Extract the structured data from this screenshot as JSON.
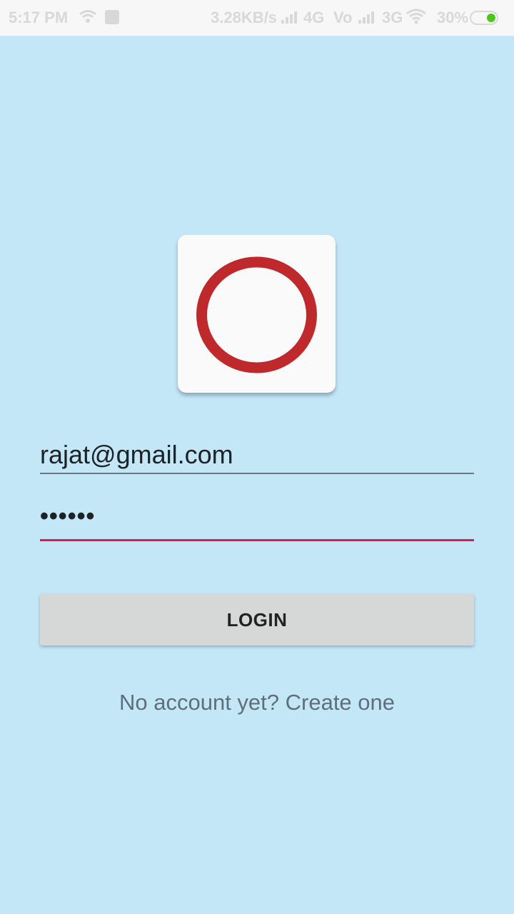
{
  "status_bar": {
    "time": "5:17 PM",
    "net_speed": "3.28KB/s",
    "network_1": "4G",
    "network_1_extra": "Vo",
    "network_2": "3G",
    "battery_percent": "30%",
    "battery_color": "#4cc71e",
    "icons": [
      "wifi-icon",
      "notification-icon",
      "signal-icon",
      "volte-icon",
      "signal-icon",
      "wifi-icon",
      "battery-icon"
    ]
  },
  "logo": {
    "icon": "red-ring-logo",
    "ring_color": "#c0292b",
    "tile_color": "#fafafa"
  },
  "form": {
    "email_value": "rajat@gmail.com",
    "password_value": "••••••",
    "focus_color": "#e0185a"
  },
  "login_button": {
    "label": "LOGIN"
  },
  "create_account": {
    "label": "No account yet? Create one"
  },
  "colors": {
    "background": "#c4e7f8",
    "button": "#d6d7d7"
  }
}
